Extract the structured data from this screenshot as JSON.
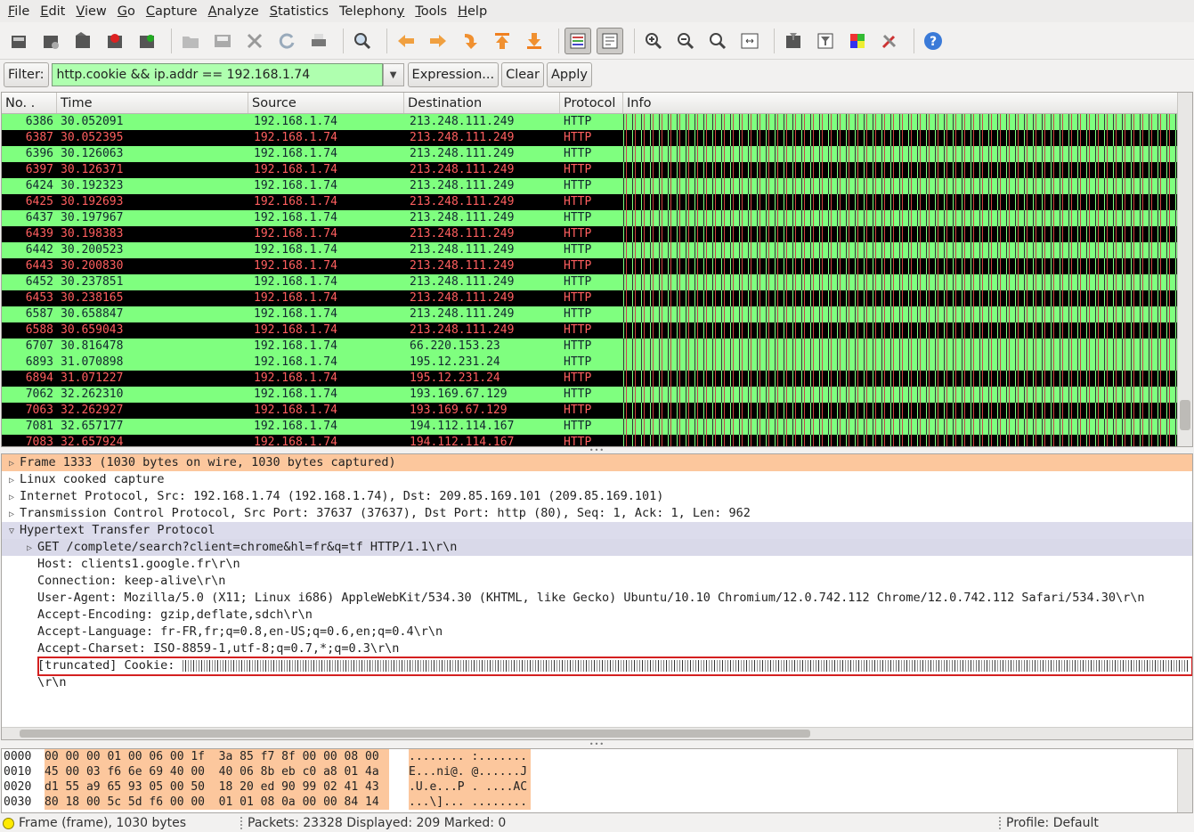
{
  "menu": [
    {
      "label": "File",
      "u": "F",
      "rest": "ile"
    },
    {
      "label": "Edit",
      "u": "E",
      "rest": "dit"
    },
    {
      "label": "View",
      "u": "V",
      "rest": "iew"
    },
    {
      "label": "Go",
      "u": "G",
      "rest": "o"
    },
    {
      "label": "Capture",
      "u": "C",
      "rest": "apture"
    },
    {
      "label": "Analyze",
      "u": "A",
      "rest": "nalyze"
    },
    {
      "label": "Statistics",
      "u": "S",
      "rest": "tatistics"
    },
    {
      "label": "Telephony",
      "u": "y",
      "pre": "Telephon",
      "rest": ""
    },
    {
      "label": "Tools",
      "u": "T",
      "rest": "ools"
    },
    {
      "label": "Help",
      "u": "H",
      "rest": "elp"
    }
  ],
  "toolbar_icons": [
    "interfaces-icon",
    "capture-options-icon",
    "start-capture-icon",
    "stop-capture-icon",
    "restart-capture-icon",
    "open-file-icon",
    "save-file-icon",
    "close-file-icon",
    "reload-icon",
    "print-icon",
    "find-packet-icon",
    "go-back-icon",
    "go-forward-icon",
    "go-to-packet-icon",
    "go-first-icon",
    "go-last-icon",
    "colorize-icon",
    "auto-scroll-icon",
    "zoom-in-icon",
    "zoom-out-icon",
    "zoom-normal-icon",
    "resize-columns-icon",
    "capture-filters-icon",
    "display-filters-icon",
    "coloring-rules-icon",
    "preferences-icon",
    "help-icon"
  ],
  "filter": {
    "label": "Filter:",
    "value": "http.cookie && ip.addr == 192.168.1.74",
    "expression": "Expression...",
    "clear": "Clear",
    "apply": "Apply"
  },
  "columns": {
    "no": "No. .",
    "time": "Time",
    "source": "Source",
    "destination": "Destination",
    "protocol": "Protocol",
    "info": "Info"
  },
  "packets": [
    {
      "no": "6386",
      "time": "30.052091",
      "src": "192.168.1.74",
      "dst": "213.248.111.249",
      "proto": "HTTP",
      "style": "g"
    },
    {
      "no": "6387",
      "time": "30.052395",
      "src": "192.168.1.74",
      "dst": "213.248.111.249",
      "proto": "HTTP",
      "style": "b"
    },
    {
      "no": "6396",
      "time": "30.126063",
      "src": "192.168.1.74",
      "dst": "213.248.111.249",
      "proto": "HTTP",
      "style": "g"
    },
    {
      "no": "6397",
      "time": "30.126371",
      "src": "192.168.1.74",
      "dst": "213.248.111.249",
      "proto": "HTTP",
      "style": "b"
    },
    {
      "no": "6424",
      "time": "30.192323",
      "src": "192.168.1.74",
      "dst": "213.248.111.249",
      "proto": "HTTP",
      "style": "g"
    },
    {
      "no": "6425",
      "time": "30.192693",
      "src": "192.168.1.74",
      "dst": "213.248.111.249",
      "proto": "HTTP",
      "style": "b"
    },
    {
      "no": "6437",
      "time": "30.197967",
      "src": "192.168.1.74",
      "dst": "213.248.111.249",
      "proto": "HTTP",
      "style": "g"
    },
    {
      "no": "6439",
      "time": "30.198383",
      "src": "192.168.1.74",
      "dst": "213.248.111.249",
      "proto": "HTTP",
      "style": "b"
    },
    {
      "no": "6442",
      "time": "30.200523",
      "src": "192.168.1.74",
      "dst": "213.248.111.249",
      "proto": "HTTP",
      "style": "g"
    },
    {
      "no": "6443",
      "time": "30.200830",
      "src": "192.168.1.74",
      "dst": "213.248.111.249",
      "proto": "HTTP",
      "style": "b"
    },
    {
      "no": "6452",
      "time": "30.237851",
      "src": "192.168.1.74",
      "dst": "213.248.111.249",
      "proto": "HTTP",
      "style": "g"
    },
    {
      "no": "6453",
      "time": "30.238165",
      "src": "192.168.1.74",
      "dst": "213.248.111.249",
      "proto": "HTTP",
      "style": "b"
    },
    {
      "no": "6587",
      "time": "30.658847",
      "src": "192.168.1.74",
      "dst": "213.248.111.249",
      "proto": "HTTP",
      "style": "g"
    },
    {
      "no": "6588",
      "time": "30.659043",
      "src": "192.168.1.74",
      "dst": "213.248.111.249",
      "proto": "HTTP",
      "style": "b"
    },
    {
      "no": "6707",
      "time": "30.816478",
      "src": "192.168.1.74",
      "dst": "66.220.153.23",
      "proto": "HTTP",
      "style": "g"
    },
    {
      "no": "6893",
      "time": "31.070898",
      "src": "192.168.1.74",
      "dst": "195.12.231.24",
      "proto": "HTTP",
      "style": "g"
    },
    {
      "no": "6894",
      "time": "31.071227",
      "src": "192.168.1.74",
      "dst": "195.12.231.24",
      "proto": "HTTP",
      "style": "b"
    },
    {
      "no": "7062",
      "time": "32.262310",
      "src": "192.168.1.74",
      "dst": "193.169.67.129",
      "proto": "HTTP",
      "style": "g"
    },
    {
      "no": "7063",
      "time": "32.262927",
      "src": "192.168.1.74",
      "dst": "193.169.67.129",
      "proto": "HTTP",
      "style": "b"
    },
    {
      "no": "7081",
      "time": "32.657177",
      "src": "192.168.1.74",
      "dst": "194.112.114.167",
      "proto": "HTTP",
      "style": "g"
    },
    {
      "no": "7083",
      "time": "32.657924",
      "src": "192.168.1.74",
      "dst": "194.112.114.167",
      "proto": "HTTP",
      "style": "b"
    }
  ],
  "details": [
    {
      "text": "Frame 1333 (1030 bytes on wire, 1030 bytes captured)",
      "tri": "closed",
      "level": 1,
      "style": "sel1"
    },
    {
      "text": "Linux cooked capture",
      "tri": "closed",
      "level": 1,
      "style": ""
    },
    {
      "text": "Internet Protocol, Src: 192.168.1.74 (192.168.1.74), Dst: 209.85.169.101 (209.85.169.101)",
      "tri": "closed",
      "level": 1,
      "style": ""
    },
    {
      "text": "Transmission Control Protocol, Src Port: 37637 (37637), Dst Port: http (80), Seq: 1, Ack: 1, Len: 962",
      "tri": "closed",
      "level": 1,
      "style": ""
    },
    {
      "text": "Hypertext Transfer Protocol",
      "tri": "open",
      "level": 1,
      "style": "sel2"
    },
    {
      "text": "GET /complete/search?client=chrome&hl=fr&q=tf HTTP/1.1\\r\\n",
      "tri": "closed",
      "level": 2,
      "style": "sel3"
    },
    {
      "text": "Host: clients1.google.fr\\r\\n",
      "tri": "",
      "level": 3,
      "style": ""
    },
    {
      "text": "Connection: keep-alive\\r\\n",
      "tri": "",
      "level": 3,
      "style": ""
    },
    {
      "text": "User-Agent: Mozilla/5.0 (X11; Linux i686) AppleWebKit/534.30 (KHTML, like Gecko) Ubuntu/10.10 Chromium/12.0.742.112 Chrome/12.0.742.112 Safari/534.30\\r\\n",
      "tri": "",
      "level": 3,
      "style": ""
    },
    {
      "text": "Accept-Encoding: gzip,deflate,sdch\\r\\n",
      "tri": "",
      "level": 3,
      "style": ""
    },
    {
      "text": "Accept-Language: fr-FR,fr;q=0.8,en-US;q=0.6,en;q=0.4\\r\\n",
      "tri": "",
      "level": 3,
      "style": ""
    },
    {
      "text": "Accept-Charset: ISO-8859-1,utf-8;q=0.7,*;q=0.3\\r\\n",
      "tri": "",
      "level": 3,
      "style": ""
    },
    {
      "text": "[truncated] Cookie: ",
      "tri": "",
      "level": 3,
      "style": "cookie"
    },
    {
      "text": "\\r\\n",
      "tri": "",
      "level": 3,
      "style": ""
    }
  ],
  "hex": [
    {
      "off": "0000",
      "bytes": "00 00 00 01 00 06 00 1f  3a 85 f7 8f 00 00 08 00",
      "ascii": "........ :......."
    },
    {
      "off": "0010",
      "bytes": "45 00 03 f6 6e 69 40 00  40 06 8b eb c0 a8 01 4a",
      "ascii": "E...ni@. @......J"
    },
    {
      "off": "0020",
      "bytes": "d1 55 a9 65 93 05 00 50  18 20 ed 90 99 02 41 43",
      "ascii": ".U.e...P . ....AC"
    },
    {
      "off": "0030",
      "bytes": "80 18 00 5c 5d f6 00 00  01 01 08 0a 00 00 84 14",
      "ascii": "...\\]... ........"
    }
  ],
  "status": {
    "frame": "Frame (frame), 1030 bytes",
    "packets": "Packets: 23328 Displayed: 209 Marked: 0",
    "profile": "Profile: Default"
  },
  "colors": {
    "green_row": "#7fff7f",
    "black_row": "#000000",
    "black_row_text": "#ff5f5f",
    "filter_ok": "#afffaf",
    "selected_frame": "#fcc79d",
    "cookie_highlight": "#d42020"
  }
}
